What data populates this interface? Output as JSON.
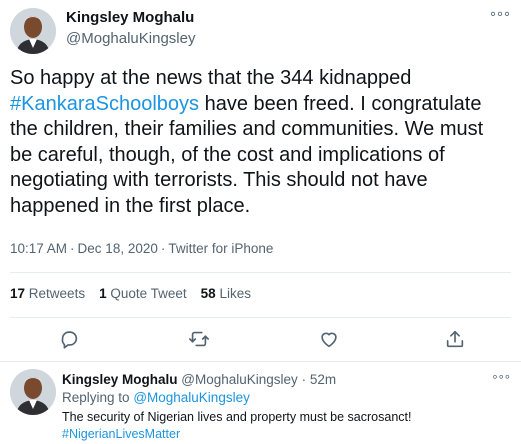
{
  "tweet": {
    "author_name": "Kingsley Moghalu",
    "author_handle": "@MoghaluKingsley",
    "text_lines": [
      "So happy at the news that the 344 kidnapped",
      "#KankaraSchoolboys",
      " have been freed. I congratulate",
      "the children, their families and communities. We must",
      "be careful, though, of the cost and implications of",
      "negotiating  with terrorists. This should not have",
      "happened in the first place."
    ],
    "time": "10:17 AM",
    "date": "Dec 18, 2020",
    "source": "Twitter for iPhone",
    "dot": "·"
  },
  "stats": {
    "retweets_count": "17",
    "retweets_label": "Retweets",
    "quotes_count": "1",
    "quotes_label": "Quote Tweet",
    "likes_count": "58",
    "likes_label": "Likes"
  },
  "actions": {
    "icons": [
      "reply-icon",
      "retweet-icon",
      "like-icon",
      "share-icon"
    ]
  },
  "reply": {
    "author_name": "Kingsley Moghalu",
    "author_handle": "@MoghaluKingsley",
    "dot": "·",
    "time_ago": "52m",
    "replying_prefix": "Replying to",
    "replying_to": "@MoghaluKingsley",
    "text": "The security of Nigerian lives and property must be sacrosanct!",
    "hashtag": "#NigerianLivesMatter"
  },
  "more_label": "°°°",
  "colors": {
    "link": "#1b95e0",
    "muted": "#536471",
    "text": "#0f1419",
    "divider": "#e6ecf0"
  }
}
